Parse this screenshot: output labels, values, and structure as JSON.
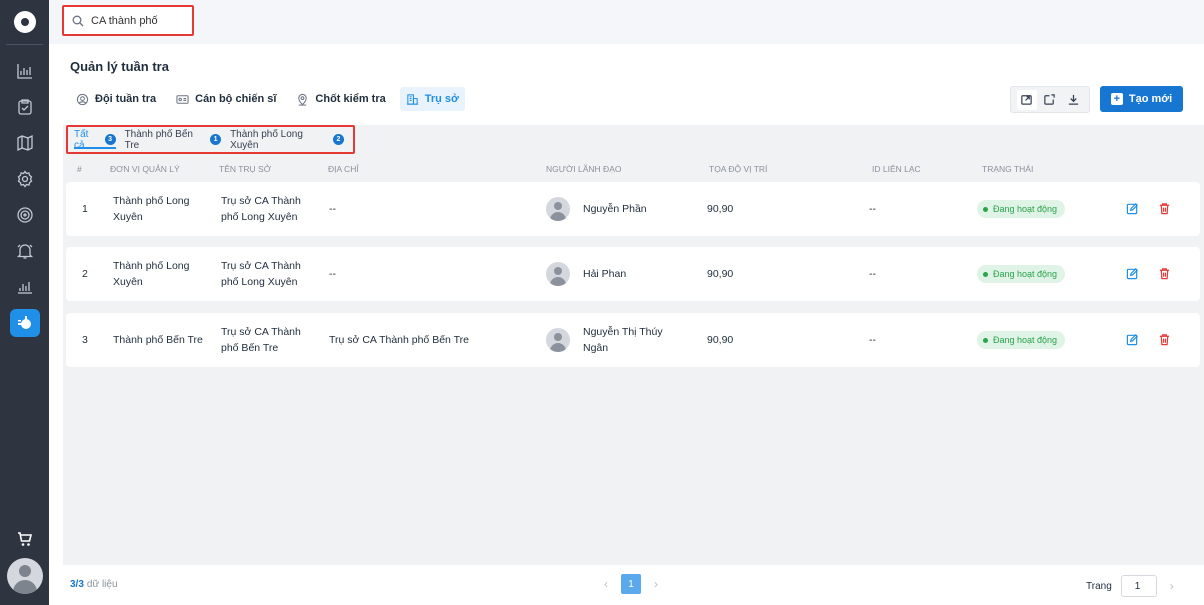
{
  "search": {
    "value": "CA thành phố"
  },
  "page": {
    "title": "Quản lý tuần tra"
  },
  "tabs": [
    {
      "label": "Đội tuần tra",
      "icon": "team-icon"
    },
    {
      "label": "Cán bộ chiến sĩ",
      "icon": "id-card-icon"
    },
    {
      "label": "Chốt kiểm tra",
      "icon": "location-pin-icon"
    },
    {
      "label": "Trụ sở",
      "icon": "building-icon"
    }
  ],
  "toolbar": {
    "create_label": "Tạo mới",
    "tools": [
      "export-icon",
      "share-icon",
      "download-icon"
    ]
  },
  "filters": [
    {
      "label": "Tất cả",
      "count": "3"
    },
    {
      "label": "Thành phố Bến Tre",
      "count": "1"
    },
    {
      "label": "Thành phố Long Xuyên",
      "count": "2"
    }
  ],
  "table": {
    "headers": {
      "index": "#",
      "unit": "ĐƠN VỊ QUẢN LÝ",
      "office": "TÊN TRỤ SỞ",
      "address": "ĐỊA CHỈ",
      "leader": "NGƯỜI LÃNH ĐẠO",
      "coords": "TỌA ĐỘ VỊ TRÍ",
      "contact": "ID LIÊN LẠC",
      "status": "TRẠNG THÁI"
    },
    "rows": [
      {
        "index": "1",
        "unit": "Thành phố Long Xuyên",
        "office": "Trụ sở CA Thành phố Long Xuyên",
        "address": "--",
        "leader": "Nguyễn Phần",
        "coords": "90,90",
        "contact": "--",
        "status": "Đang hoạt động"
      },
      {
        "index": "2",
        "unit": "Thành phố Long Xuyên",
        "office": "Trụ sở CA Thành phố Long Xuyên",
        "address": "--",
        "leader": "Hải Phan",
        "coords": "90,90",
        "contact": "--",
        "status": "Đang hoạt động"
      },
      {
        "index": "3",
        "unit": "Thành phố Bến Tre",
        "office": "Trụ sở CA Thành phố Bến Tre",
        "address": "Trụ sở CA Thành phố Bến Tre",
        "leader": "Nguyễn Thị Thúy Ngân",
        "coords": "90,90",
        "contact": "--",
        "status": "Đang hoạt động"
      }
    ]
  },
  "footer": {
    "count": "3/3",
    "count_unit": "dữ liệu",
    "current_page": "1",
    "goto_label": "Trang",
    "goto_value": "1"
  },
  "colors": {
    "accent": "#1676d2",
    "highlight": "#e53935",
    "sidebar": "#2e3440",
    "status": "#2aa34a"
  }
}
